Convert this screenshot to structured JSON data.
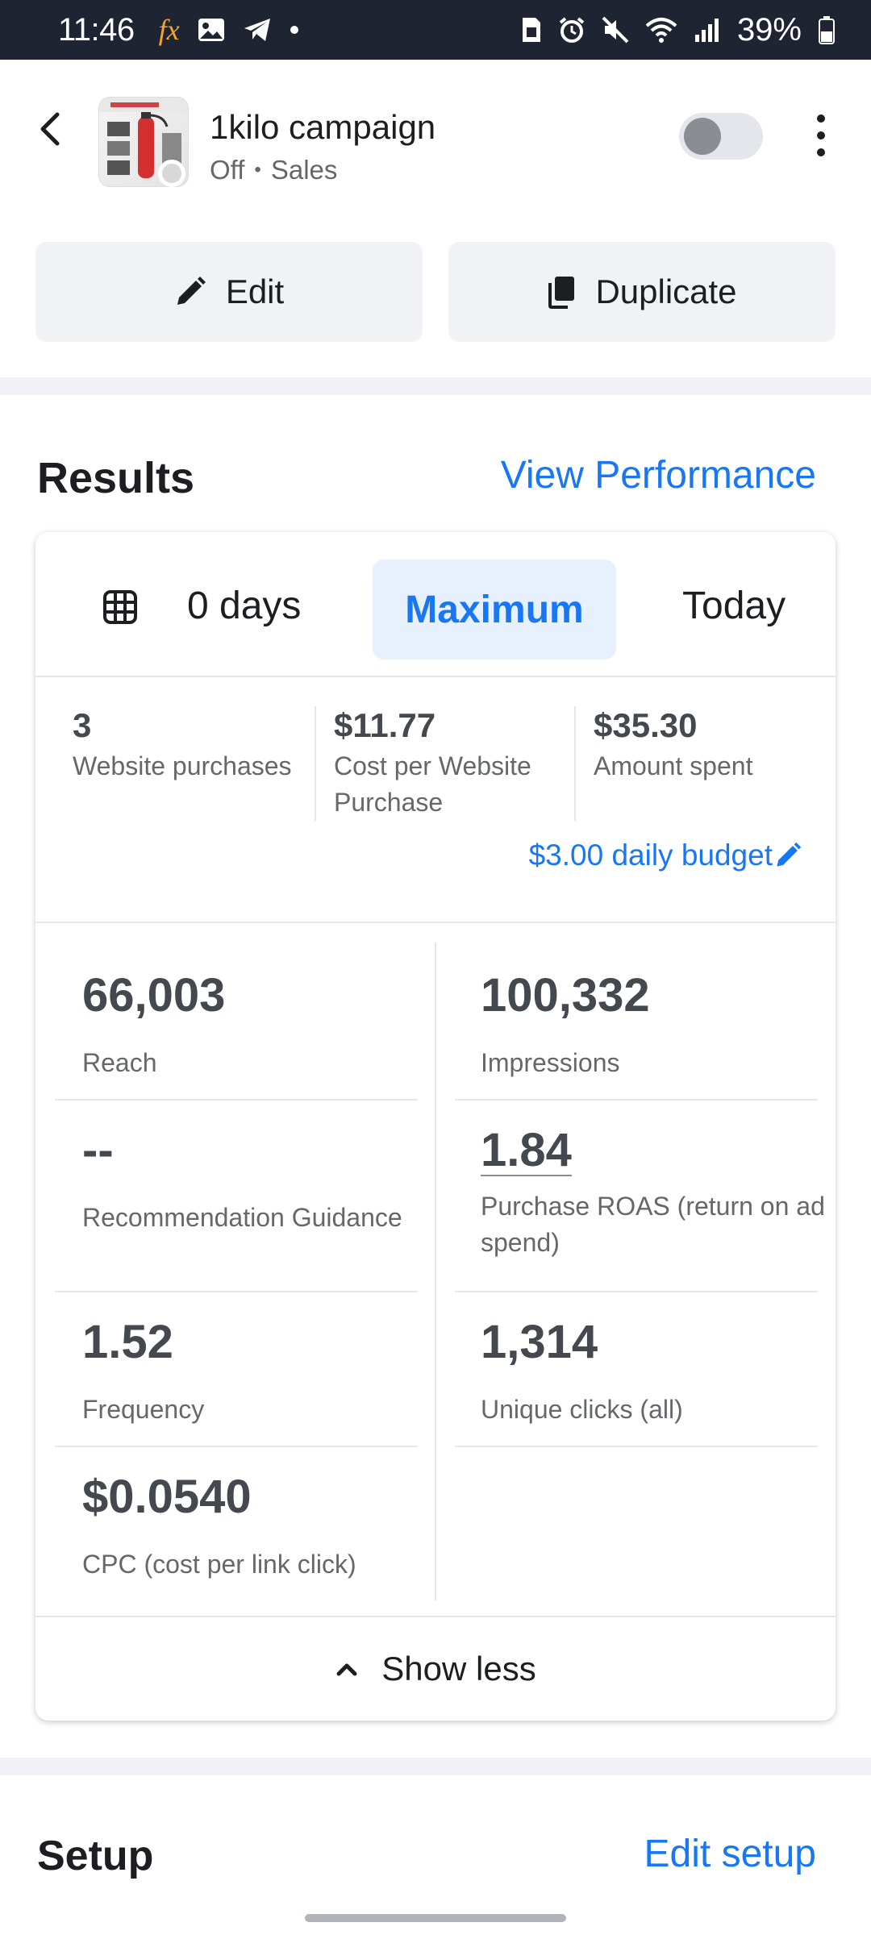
{
  "status_bar": {
    "time": "11:46",
    "battery": "39%"
  },
  "header": {
    "campaign_name": "1kilo campaign",
    "status": "Off",
    "objective": "Sales",
    "separator": "•"
  },
  "actions": {
    "edit_label": "Edit",
    "duplicate_label": "Duplicate"
  },
  "results": {
    "title": "Results",
    "view_performance_label": "View Performance",
    "date_range": {
      "days_label": "0 days",
      "selected": "Maximum",
      "today": "Today"
    },
    "summary": [
      {
        "value": "3",
        "label": "Website purchases"
      },
      {
        "value": "$11.77",
        "label": "Cost per Website Purchase"
      },
      {
        "value": "$35.30",
        "label": "Amount spent"
      }
    ],
    "daily_budget": "$3.00 daily budget",
    "metrics": [
      {
        "value": "66,003",
        "label": "Reach"
      },
      {
        "value": "100,332",
        "label": "Impressions"
      },
      {
        "value": "--",
        "label": "Recommendation Guidance"
      },
      {
        "value": "1.84",
        "label": "Purchase ROAS (return on ad spend)"
      },
      {
        "value": "1.52",
        "label": "Frequency"
      },
      {
        "value": "1,314",
        "label": "Unique clicks (all)"
      },
      {
        "value": "$0.0540",
        "label": "CPC (cost per link click)"
      }
    ],
    "show_less_label": "Show less"
  },
  "setup": {
    "title": "Setup",
    "edit_setup_label": "Edit setup"
  },
  "colors": {
    "accent": "#1877f2",
    "status_bar_bg": "#1f2433",
    "page_bg": "#f0f2f5"
  }
}
